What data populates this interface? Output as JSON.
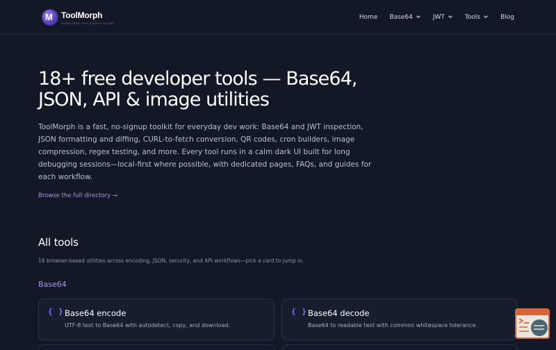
{
  "brand": {
    "name": "ToolMorph",
    "tagline": "DEVELOPER TOOLS AND UTILITIES"
  },
  "nav": {
    "items": [
      {
        "label": "Home",
        "has_menu": false
      },
      {
        "label": "Base64",
        "has_menu": true
      },
      {
        "label": "JWT",
        "has_menu": true
      },
      {
        "label": "Tools",
        "has_menu": true
      },
      {
        "label": "Blog",
        "has_menu": false
      }
    ]
  },
  "hero": {
    "title": "18+ free developer tools — Base64, JSON, API & image utilities",
    "description": "ToolMorph is a fast, no-signup toolkit for everyday dev work: Base64 and JWT inspection, JSON formatting and diffing, CURL-to-fetch conversion, QR codes, cron builders, image compression, regex testing, and more. Every tool runs in a calm dark UI built for long debugging sessions—local-first where possible, with dedicated pages, FAQs, and guides for each workflow.",
    "link_label": "Browse the full directory →"
  },
  "tools_section": {
    "title": "All tools",
    "subtitle": "18 browser-based utilities across encoding, JSON, security, and API workflows—pick a card to jump in.",
    "categories": [
      {
        "name": "Base64",
        "cards": [
          {
            "icon": "{ }",
            "title": "Base64 encode",
            "description": "UTF-8 text to Base64 with autodetect, copy, and download."
          },
          {
            "icon": "{ }",
            "title": "Base64 decode",
            "description": "Base64 to readable text with common whitespace tolerance."
          }
        ]
      }
    ]
  },
  "colors": {
    "background": "#121826",
    "accent": "#8e72ff",
    "link": "#a596f0",
    "card_bg": "#161d2c",
    "widget_border": "#d9643a"
  },
  "icons": {
    "logo": "toolmorph-logo-icon",
    "chevron": "chevron-down-icon",
    "card": "curly-braces-icon",
    "widget": "terminal-chat-icon"
  }
}
